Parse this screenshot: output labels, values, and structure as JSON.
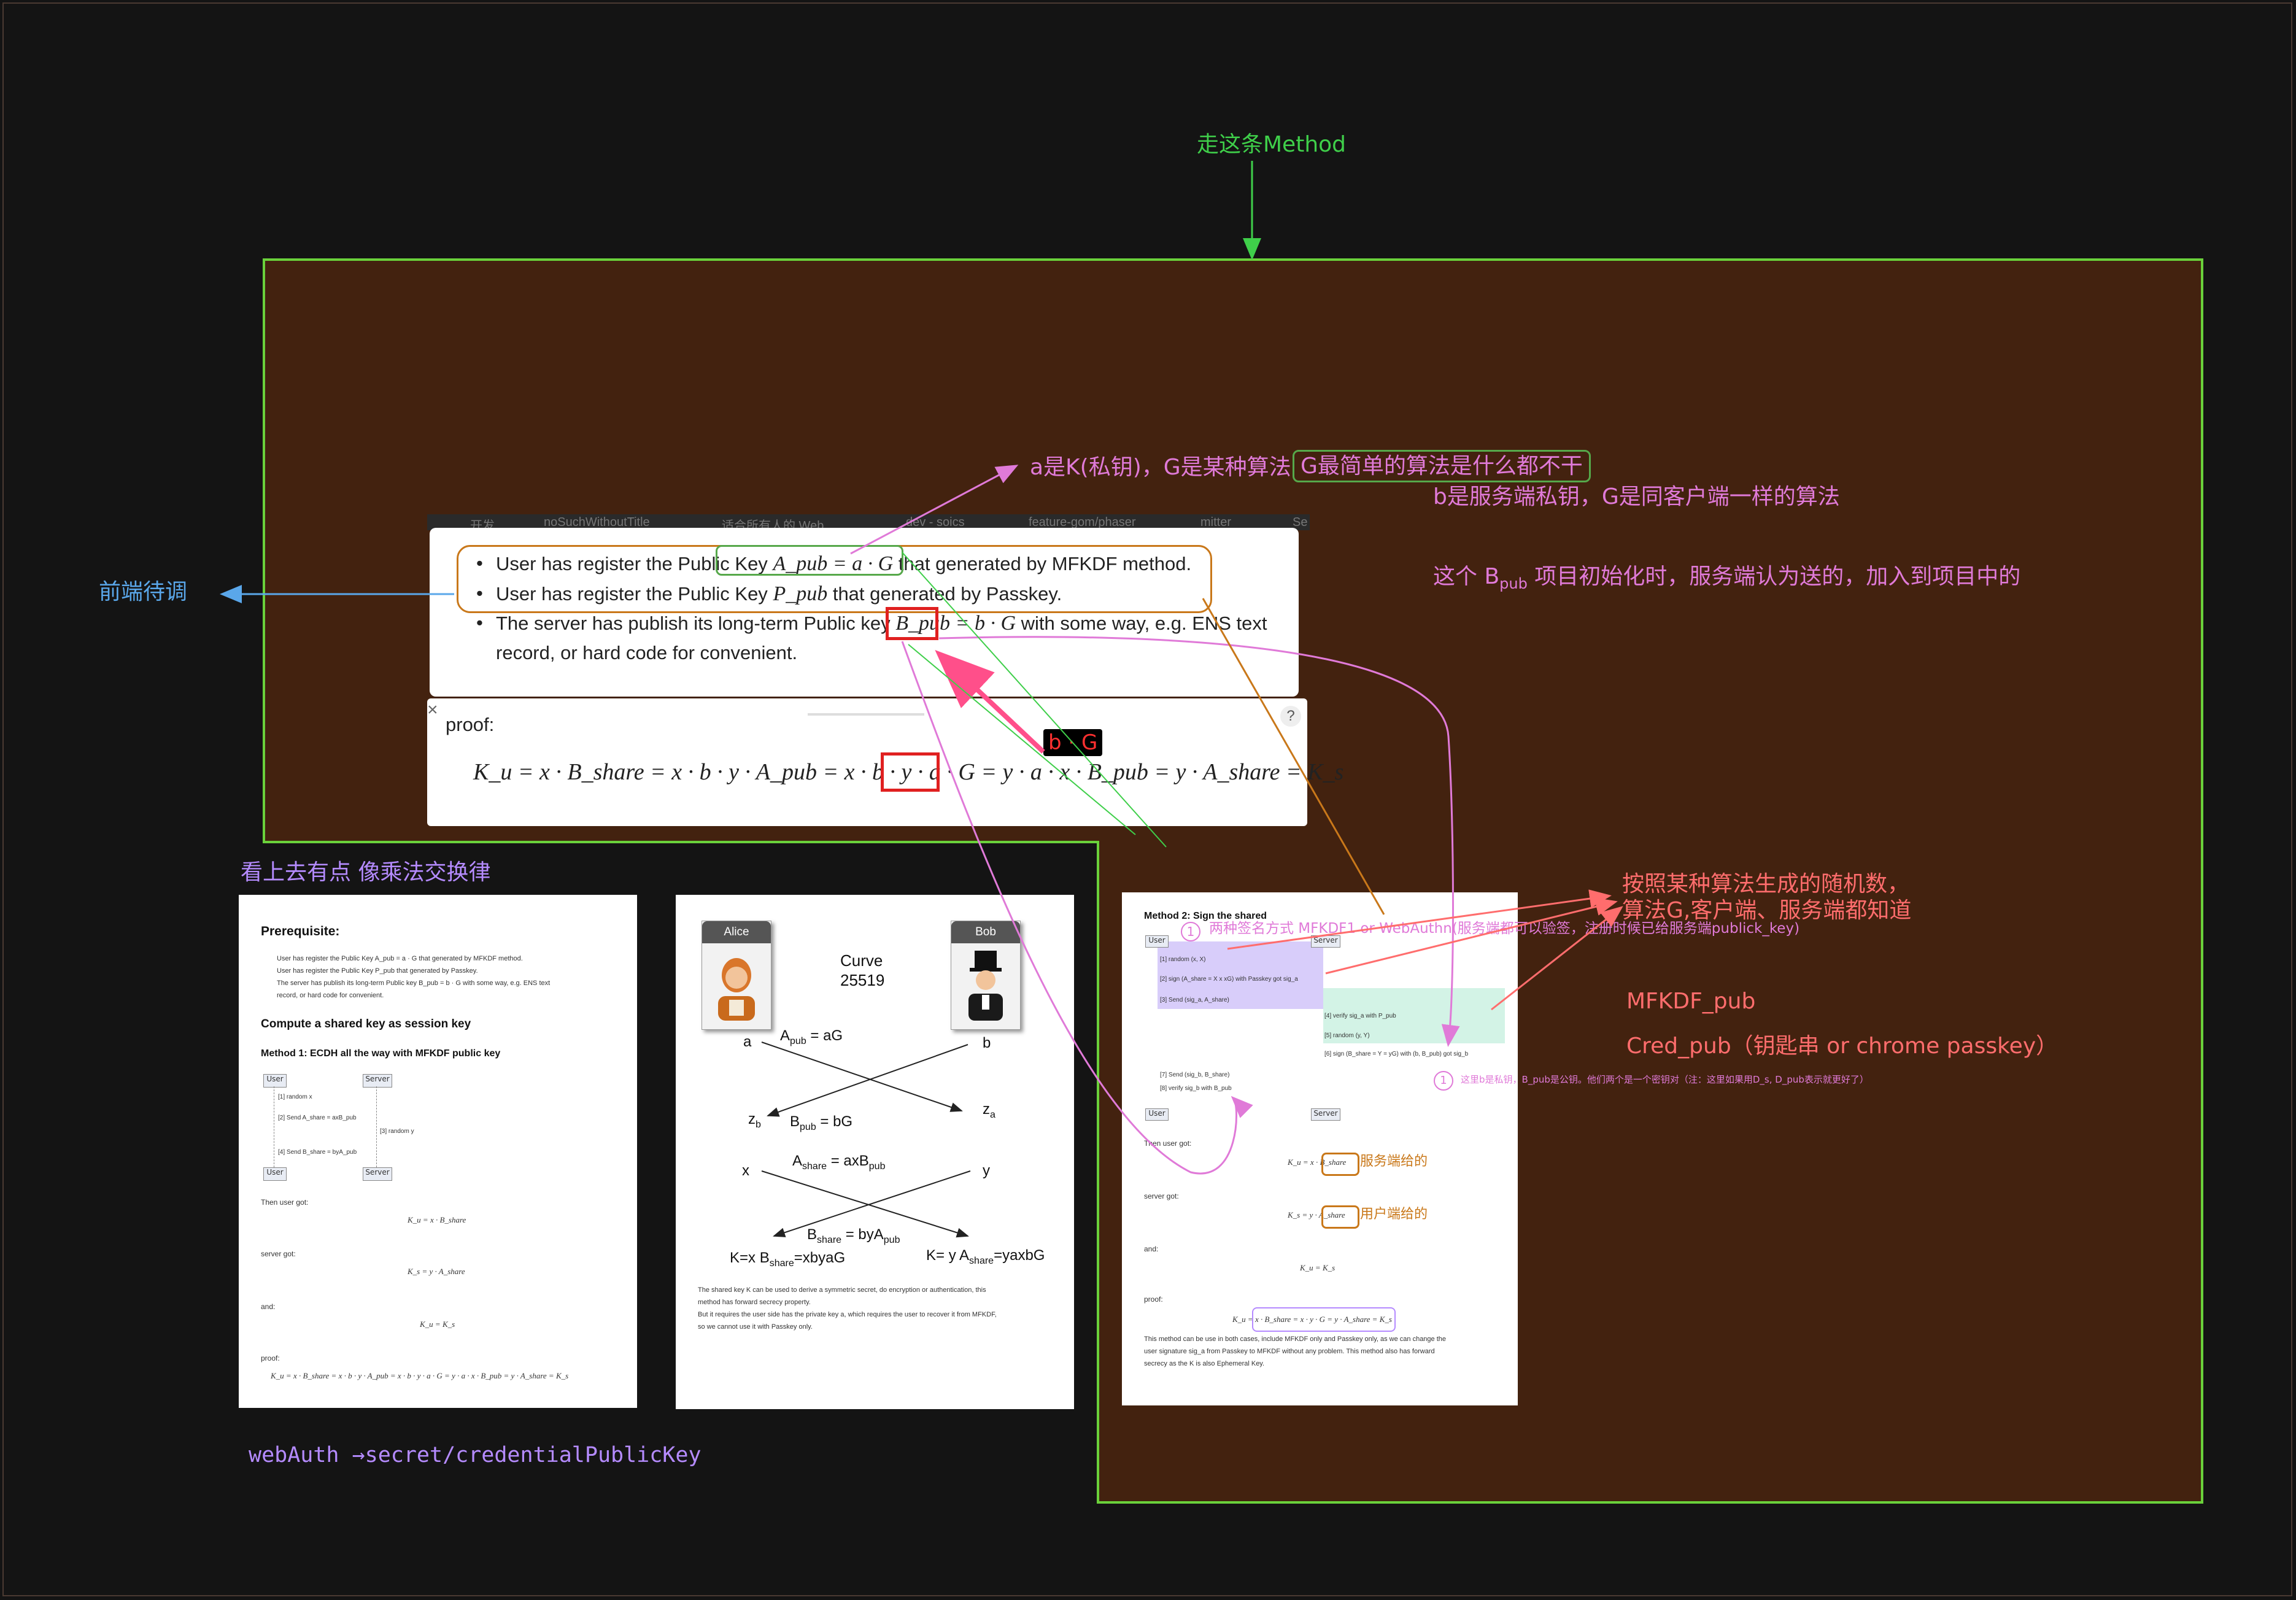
{
  "annotations": {
    "method_path": "走这条Method",
    "a_is_k": "a是K(私钥)，G是某种算法",
    "g_simplest": "G最简单的算法是什么都不干",
    "b_server_key": "b是服务端私钥，G是同客户端一样的算法",
    "bpub_note_pre": "这个 B",
    "bpub_note_sub": "pub",
    "bpub_note_post": " 项目初始化时，服务端认为送的，加入到项目中的",
    "frontend_pending": "前端待调",
    "commutative": "看上去有点  像乘法交换律",
    "random_algo_1": "按照某种算法生成的随机数，",
    "random_algo_2": "算法G,客户端、服务端都知道",
    "mfkdf_pub": "MFKDF_pub",
    "cred_pub": "Cred_pub（钥匙串 or chrome passkey）",
    "webauth": "webAuth →secret/credentialPublicKey",
    "bg_label": "b · G",
    "two_sign_methods": "两种签名方式 MFKDF1 or WebAuthn(服务端都可以验签，注册时候已给服务端publick_key)",
    "b_private_note": "这里b是私钥，B_pub是公钥。他们两个是一个密钥对（注：这里如果用D_s, D_pub表示就更好了）",
    "server_gave": "服务端给的",
    "user_gave": "用户端给的",
    "circle_1": "1"
  },
  "browser_tabs": [
    "开发",
    "noSuchWithoutTitle",
    "适合所有人的 Web...",
    "dev - soics",
    "feature-gom/phaser",
    "mitter",
    "Se"
  ],
  "top_panel": {
    "bullet1_pre": "User has register the Public Key ",
    "bullet1_math": "A_pub = a · G",
    "bullet1_post": " that generated by MFKDF method.",
    "bullet2_pre": "User has register the Public Key ",
    "bullet2_math": "P_pub",
    "bullet2_post": " that generated by Passkey.",
    "bullet3_pre": "The server has publish its long-term Public key ",
    "bullet3_math": "B_pub = b · G",
    "bullet3_post": " with some way, e.g. ENS text",
    "bullet3_line2": "record, or hard code for convenient.",
    "proof_label": "proof:",
    "proof_formula": "K_u = x · B_share = x · b · y · A_pub = x · b · y · a · G = y · a · x · B_pub = y · A_share = K_s",
    "help_icon": "?",
    "close_icon": "×"
  },
  "doc_left": {
    "prereq_title": "Prerequisite:",
    "prereq_items": [
      "User has register the Public Key A_pub = a · G that generated by MFKDF method.",
      "User has register the Public Key P_pub that generated by Passkey.",
      "The server has publish its long-term Public key B_pub = b · G with some way, e.g. ENS text",
      "record, or hard code for convenient."
    ],
    "compute_title": "Compute a shared key as session key",
    "method1_title": "Method 1: ECDH all the way with MFKDF public key",
    "seq_user": "User",
    "seq_server": "Server",
    "seq_steps": [
      "[1] random x",
      "[2] Send A_share = axB_pub",
      "[3] random y",
      "[4] Send B_share = byA_pub"
    ],
    "user_got_label": "Then user got:",
    "user_got_formula": "K_u = x · B_share",
    "server_got_label": "server got:",
    "server_got_formula": "K_s = y · A_share",
    "and_label": "and:",
    "and_formula": "K_u = K_s",
    "proof_label": "proof:",
    "proof_formula": "K_u = x · B_share = x · b · y · A_pub = x · b · y · a · G = y · a · x · B_pub = y · A_share = K_s"
  },
  "doc_middle": {
    "alice": "Alice",
    "bob": "Bob",
    "curve_line1": "Curve",
    "curve_line2": "25519",
    "a": "a",
    "b": "b",
    "apub": "A",
    "apub_sub": "pub",
    "apub_val": " = aG",
    "zb": "z",
    "zb_sub": "b",
    "za": "z",
    "za_sub": "a",
    "bpub": "B",
    "bpub_sub": "pub",
    "bpub_val": " = bG",
    "x": "x",
    "y": "y",
    "ashare": "A",
    "ashare_sub": "share",
    "ashare_val": " = axB",
    "ashare_val_sub": "pub",
    "bshare": "B",
    "bshare_sub": "share",
    "bshare_val": " = byA",
    "bshare_val_sub": "pub",
    "k_left_pre": "K=x B",
    "k_left_sub": "share",
    "k_left_post": "=xbyaG",
    "k_right_pre": "K= y A",
    "k_right_sub": "share",
    "k_right_post": "=yaxbG",
    "para1": "The shared key K can be used to derive a symmetric secret, do encryption or authentication, this",
    "para2": "method has forward secrecy property.",
    "para3": "But it requires the user side has the private key a, which requires the user to recover it from MFKDF,",
    "para4": "so we cannot use it with Passkey only."
  },
  "doc_right": {
    "title": "Method 2: Sign the shared",
    "seq_user": "User",
    "seq_server": "Server",
    "steps": [
      "[1] random (x, X)",
      "[2] sign (A_share = X x xG) with Passkey got sig_a",
      "[3] Send (sig_a, A_share)",
      "[4] verify sig_a with P_pub",
      "[5] random (y, Y)",
      "[6] sign (B_share = Y = yG) with (b, B_pub) got sig_b",
      "[7] Send (sig_b, B_share)",
      "[8] verify sig_b with B_pub"
    ],
    "user_got_label": "Then user got:",
    "user_got_formula": "K_u = x · B_share",
    "server_got_label": "server got:",
    "server_got_formula": "K_s = y · A_share",
    "and_label": "and:",
    "and_formula": "K_u = K_s",
    "proof_label": "proof:",
    "proof_formula": "K_u = x · B_share = x · y · G = y · A_share = K_s",
    "para1": "This method can be use in both cases, include MFKDF only and Passkey only, as we can change the",
    "para2": "user signature sig_a from Passkey to MFKDF without any problem. This method also has forward",
    "para3": "secrecy as the K is also Ephemeral Key."
  },
  "colors": {
    "background": "#141414",
    "region_fill": "#43220f",
    "region_border": "#6ad13b",
    "annotation_green": "#3fcf4a",
    "annotation_pink": "#e07ad8",
    "annotation_blue": "#5aa7ea",
    "annotation_red": "#ff5a5a",
    "annotation_violet": "#b58bff",
    "orange_outline": "#c9781a",
    "green_outline": "#56a84a",
    "red_box": "#e02020"
  }
}
